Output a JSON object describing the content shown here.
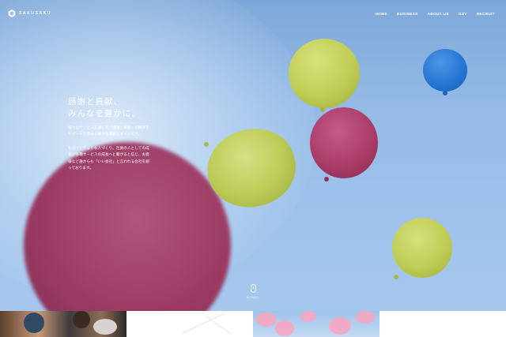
{
  "brand": {
    "name": "SAKUSAKU"
  },
  "nav": {
    "items": [
      "HOME",
      "BUSINESS",
      "ABOUT US",
      "GSV",
      "RECRUIT"
    ]
  },
  "hero": {
    "heading_line1": "感謝と貢献、",
    "heading_line2": "みんなを豊かに。",
    "para1": "様々なサービスを通して「感謝と貢献」の精神をサポートを求める様々な事業をメインです。",
    "para2": "ものづくりよりも人づくり。社員の人としての成長が各種サービスの成長へと繋がると信じ、お客様など誰からも「いい会社」と言われる会社を創っております。",
    "scroll_label": "SCROLL"
  },
  "colors": {
    "sky_top": "#7ea8d9",
    "sky_bottom": "#a7c8ee",
    "balloon_magenta": "#9b3b64",
    "balloon_green": "#bfcd55",
    "balloon_blue": "#2474d2"
  },
  "strip": {
    "tiles": [
      "team-meeting-photo",
      "white-graphic",
      "cherry-blossom-photo",
      "white-graphic"
    ]
  }
}
